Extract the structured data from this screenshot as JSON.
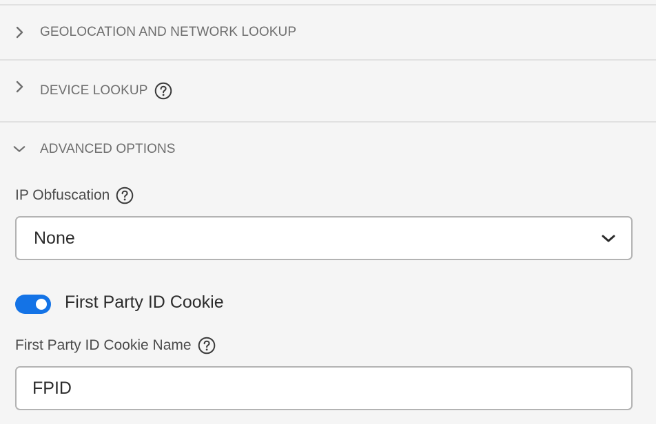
{
  "sections": {
    "geolocation": {
      "label": "GEOLOCATION AND NETWORK LOOKUP",
      "expanded": false
    },
    "device_lookup": {
      "label": "DEVICE LOOKUP",
      "expanded": false
    },
    "advanced_options": {
      "label": "ADVANCED OPTIONS",
      "expanded": true
    }
  },
  "ip_obfuscation": {
    "label": "IP Obfuscation",
    "selected": "None"
  },
  "first_party_toggle": {
    "label": "First Party ID Cookie",
    "checked": true
  },
  "cookie_name": {
    "label": "First Party ID Cookie Name",
    "value": "FPID"
  },
  "icons": [
    "chevron-right-icon",
    "chevron-down-icon",
    "help-icon"
  ],
  "colors": {
    "toggle_on": "#1473e6",
    "background": "#f5f5f5",
    "field_border": "#b3b3b3",
    "section_text": "#6e6e6e"
  }
}
